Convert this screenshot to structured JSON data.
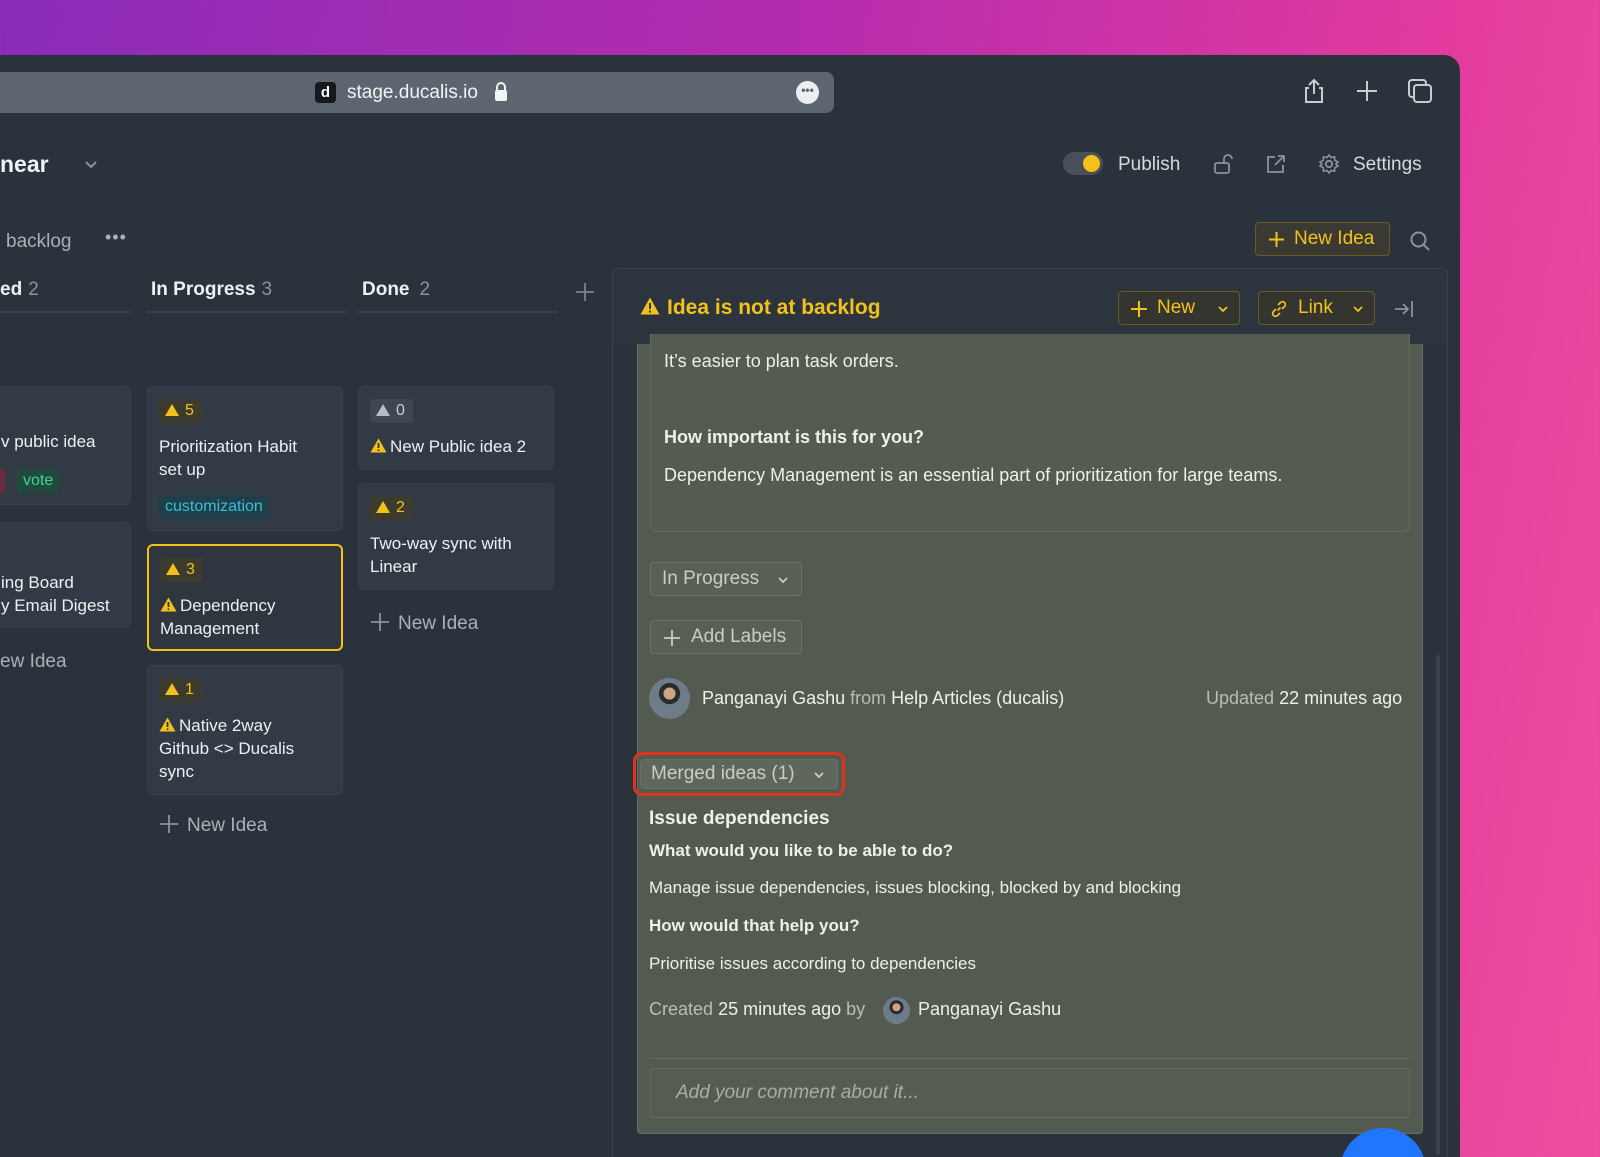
{
  "browser": {
    "favicon": "d",
    "url": "stage.ducalis.io",
    "more": "•••"
  },
  "header": {
    "board_title": "near",
    "publish_label": "Publish",
    "settings_label": "Settings"
  },
  "subheader": {
    "backlog_label": "backlog",
    "more": "•••",
    "new_idea_label": "New Idea"
  },
  "columns": [
    {
      "name": "ed",
      "count": "2",
      "cards": [
        {
          "title": "v public idea",
          "labels": [
            "vote"
          ]
        },
        {
          "title_lines": [
            "ing Board",
            "y Email Digest"
          ]
        }
      ],
      "add_label": "ew Idea"
    },
    {
      "name": "In Progress",
      "count": "3",
      "cards": [
        {
          "votes": "5",
          "title_lines": [
            "Prioritization Habit",
            "set up"
          ],
          "labels": [
            "customization"
          ]
        },
        {
          "votes": "3",
          "title_lines": [
            "Dependency",
            "Management"
          ],
          "warning": true,
          "selected": true
        },
        {
          "votes": "1",
          "title_lines": [
            "Native 2way",
            "Github <> Ducalis",
            "sync"
          ],
          "warning": true
        }
      ],
      "add_label": "New Idea"
    },
    {
      "name": "Done",
      "count": "2",
      "cards": [
        {
          "votes": "0",
          "title_lines": [
            "New Public idea 2"
          ],
          "warning": true
        },
        {
          "votes": "2",
          "title_lines": [
            "Two-way sync with",
            "Linear"
          ]
        }
      ],
      "add_label": "New Idea"
    }
  ],
  "panel": {
    "warning_title": "Idea is not at backlog",
    "new_button": "New",
    "link_button": "Link",
    "desc_text_1": "It’s easier to plan task orders.",
    "question_1": "How important is this for you?",
    "answer_1": "Dependency Management is an essential part of prioritization for large teams.",
    "status_value": "In Progress",
    "add_labels": "Add Labels",
    "author_name": "Panganayi Gashu",
    "from_word": "from",
    "source": "Help Articles (ducalis)",
    "updated_word": "Updated",
    "updated_time": "22 minutes ago",
    "merged_label": "Merged ideas (1)",
    "merged": {
      "title": "Issue dependencies",
      "q1": "What would you like to be able to do?",
      "a1": "Manage issue dependencies, issues blocking, blocked by and blocking",
      "q2": "How would that help you?",
      "a2": "Prioritise issues according to dependencies",
      "created_word": "Created",
      "created_time": "25 minutes ago",
      "by_word": "by",
      "author": "Panganayi Gashu"
    },
    "comment_placeholder": "Add your comment about it..."
  },
  "colors": {
    "accent": "#f2c21a",
    "highlight": "#e0321c",
    "panel_bg": "#535a4f",
    "app_bg": "#2a323b"
  }
}
